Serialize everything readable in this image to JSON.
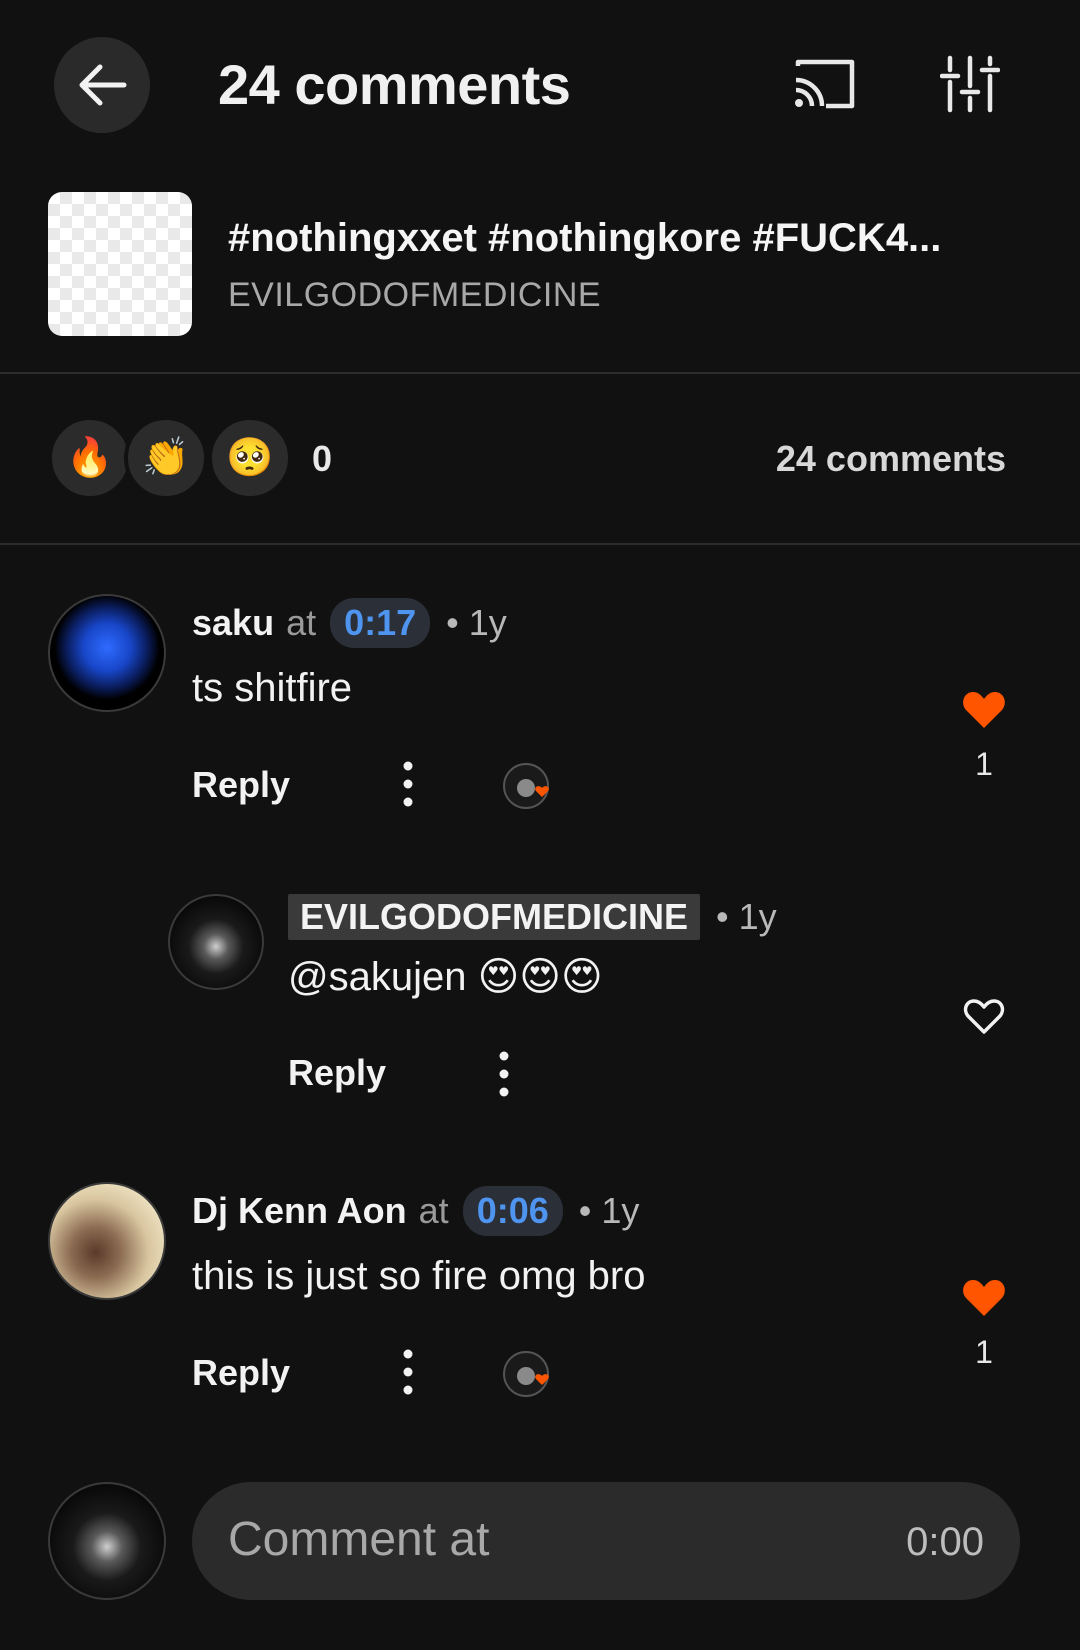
{
  "header": {
    "title": "24 comments",
    "back_icon": "arrow-left-icon",
    "cast_icon": "cast-icon",
    "filter_icon": "sliders-icon"
  },
  "track": {
    "title": "#nothingxxet #nothingkore #FUCK4...",
    "artist": "EVILGODOFMEDICINE"
  },
  "reactions": {
    "items": [
      {
        "emoji": "🔥",
        "name": "fire"
      },
      {
        "emoji": "👏",
        "name": "clap"
      },
      {
        "emoji": "🥺",
        "name": "pleading"
      }
    ],
    "count": "0",
    "comments_count": "24 comments"
  },
  "comments": [
    {
      "username": "saku",
      "at_word": "at",
      "timestamp": "0:17",
      "age": "• 1y",
      "text": "ts  shitfire",
      "reply_label": "Reply",
      "likes": "1",
      "liked": true
    },
    {
      "username": "EVILGODOFMEDICINE",
      "age": "• 1y",
      "text": "@sakujen 😍😍😍",
      "reply_label": "Reply",
      "liked": false
    },
    {
      "username": "Dj Kenn Aon",
      "at_word": "at",
      "timestamp": "0:06",
      "age": "• 1y",
      "text": "this is just so fire omg bro",
      "reply_label": "Reply",
      "likes": "1",
      "liked": true
    }
  ],
  "composer": {
    "placeholder": "Comment at",
    "time": "0:00"
  },
  "colors": {
    "background": "#111111",
    "accent_like": "#ff5500",
    "timestamp_blue": "#4f95f0"
  }
}
